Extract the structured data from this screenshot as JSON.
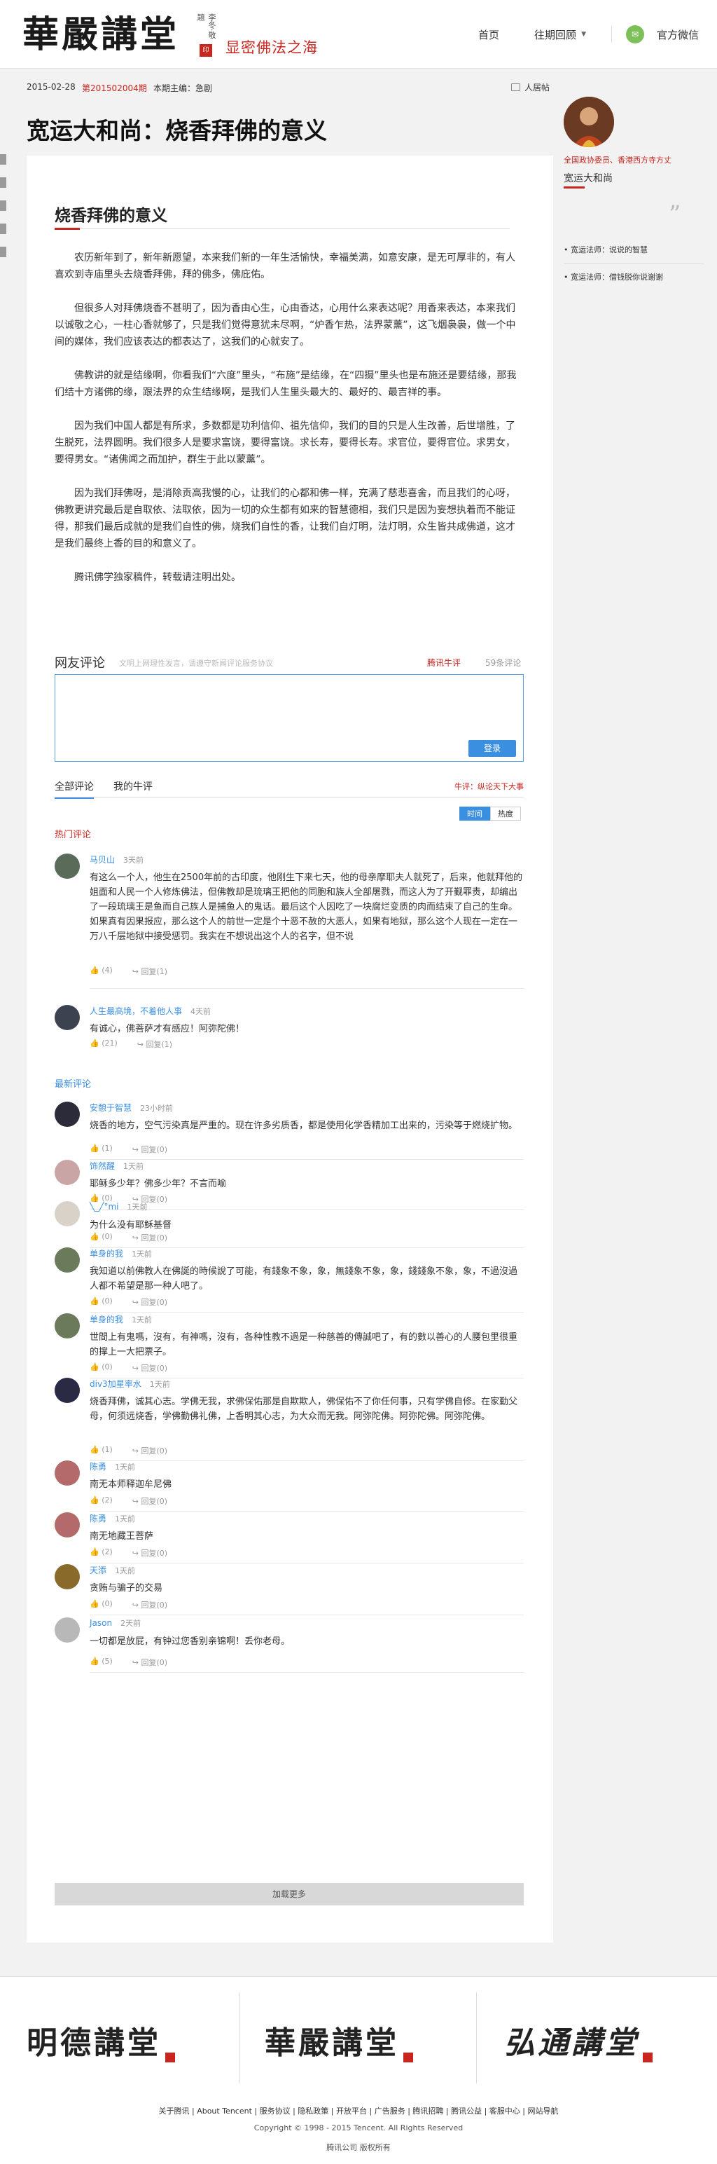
{
  "header": {
    "logo_text": "華嚴講堂",
    "logo_side": "李冬·敬題",
    "slogan": "显密佛法之海",
    "nav_home": "首页",
    "nav_archive": "往期回顾",
    "nav_wechat": "官方微信"
  },
  "infobar": {
    "date": "2015-02-28",
    "issue_prefix": "第",
    "issue_no": "201502004",
    "issue_suffix": "期",
    "editor": "本期主编：急剧",
    "people": "人居帖"
  },
  "page_title": "宽运大和尚：烧香拜佛的意义",
  "article": {
    "title": "烧香拜佛的意义",
    "paragraphs": [
      "农历新年到了，新年新愿望，本来我们新的一年生活愉快，幸福美满，如意安康，是无可厚非的，有人喜欢到寺庙里头去烧香拜佛，拜的佛多，佛庇佑。",
      "但很多人对拜佛烧香不甚明了，因为香由心生，心由香达，心用什么来表达呢？用香来表达，本来我们以诚敬之心，一柱心香就够了，只是我们觉得意犹未尽啊，“炉香乍热，法界蒙薰”，这飞烟袅袅，做一个中间的媒体，我们应该表达的都表达了，这我们的心就安了。",
      "佛教讲的就是结缘啊，你看我们“六度”里头，“布施”是结缘，在“四摄”里头也是布施还是要结缘，那我们结十方诸佛的缘，跟法界的众生结缘啊，是我们人生里头最大的、最好的、最吉祥的事。",
      "因为我们中国人都是有所求，多数都是功利信仰、祖先信仰，我们的目的只是人生改善，后世增胜，了生脱死，法界圆明。我们很多人是要求富饶，要得富饶。求长寿，要得长寿。求官位，要得官位。求男女，要得男女。“诸佛闻之而加护，群生于此以蒙薰”。",
      "因为我们拜佛呀，是消除贡高我慢的心，让我们的心都和佛一样，充满了慈悲喜舍，而且我们的心呀，佛教更讲究最后是自取依、法取依，因为一切的众生都有如来的智慧德相，我们只是因为妄想执着而不能证得，那我们最后成就的是我们自性的佛，烧我们自性的香，让我们自灯明，法灯明，众生皆共成佛道，这才是我们最终上香的目的和意义了。",
      "腾讯佛学独家稿件，转载请注明出处。"
    ]
  },
  "comments": {
    "title": "网友评论",
    "rule": "文明上网理性发言，请遵守新闻评论服务协议",
    "weiping": "腾讯牛评",
    "count": "59条评论",
    "login": "登录",
    "tab_all": "全部评论",
    "tab_mine": "我的牛评",
    "hot_topic": "牛评：纵论天下大事",
    "sort_time": "时间",
    "sort_hot": "热度",
    "hot_label": "热门评论",
    "latest_label": "最新评论",
    "load_more": "加载更多",
    "hot": [
      {
        "name": "马贝山",
        "time": "3天前",
        "text": "有这么一个人，他生在2500年前的古印度，他刚生下来七天，他的母亲摩耶夫人就死了，后来，他就拜他的姐面和人民一个人修炼佛法，但佛教却是琉璃王把他的同胞和族人全部屠戮，而这人为了开觐罪责，却编出了一段琉璃王是鱼而自己族人是捕鱼人的鬼话。最后这个人因吃了一块腐烂变质的肉而结束了自己的生命。如果真有因果报应，那么这个人的前世一定是个十恶不赦的大恶人，如果有地狱，那么这个人现在一定在一万八千层地狱中接受惩罚。我实在不想说出这个人的名字，但不说",
        "likes": "(4)",
        "reply": "回复(1)"
      },
      {
        "name": "人生最高境，不着他人事",
        "time": "4天前",
        "text": "有诚心，佛菩萨才有感应！阿弥陀佛！",
        "likes": "(21)",
        "reply": "回复(1)"
      }
    ],
    "latest": [
      {
        "name": "安憩于智慧",
        "time": "23小时前",
        "text": "烧香的地方，空气污染真是严重的。现在许多劣质香，都是使用化学香精加工出来的，污染等于燃烧扩物。",
        "likes": "(1)",
        "reply": "回复(0)"
      },
      {
        "name": "饰然醒",
        "time": "1天前",
        "text": "耶稣多少年？佛多少年？不言而喻",
        "likes": "(0)",
        "reply": "回复(0)"
      },
      {
        "name": "╲_╱°mi",
        "time": "1天前",
        "text": "为什么没有耶稣基督",
        "likes": "(0)",
        "reply": "回复(0)"
      },
      {
        "name": "单身的我",
        "time": "1天前",
        "text": "我知道以前佛教人在佛誕的時候說了可能，有錢象不象，象，無錢象不象，象，錢錢象不象，象，不過沒過人都不希望是那一种人吧了。",
        "likes": "(0)",
        "reply": "回复(0)"
      },
      {
        "name": "单身的我",
        "time": "1天前",
        "text": "世間上有鬼嗎，沒有，有神嗎，沒有，各种性教不過是一种慈善的傳誠吧了，有的數以善心的人腰包里很重的撑上一大把票子。",
        "likes": "(0)",
        "reply": "回复(0)"
      },
      {
        "name": "div3加星率水",
        "time": "1天前",
        "text": "烧香拜佛，诚其心志。学佛无我，求佛保佑那是自欺欺人，佛保佑不了你任何事，只有学佛自修。在家勤父母，何须远烧香，学佛勤佛礼佛，上香明其心志，为大众而无我。阿弥陀佛。阿弥陀佛。阿弥陀佛。",
        "likes": "(1)",
        "reply": "回复(0)"
      },
      {
        "name": "陈勇",
        "time": "1天前",
        "text": "南无本师释迦牟尼佛",
        "likes": "(2)",
        "reply": "回复(0)"
      },
      {
        "name": "陈勇",
        "time": "1天前",
        "text": "南无地藏王菩萨",
        "likes": "(2)",
        "reply": "回复(0)"
      },
      {
        "name": "天添",
        "time": "1天前",
        "text": "贪贿与骗子的交易",
        "likes": "(0)",
        "reply": "回复(0)"
      },
      {
        "name": "Jason",
        "time": "2天前",
        "text": "一切都是放屁，有钟过您香别亲锦啊！丢你老母。",
        "likes": "(5)",
        "reply": "回复(0)"
      }
    ]
  },
  "sidebar": {
    "role": "全国政协委员、香港西方寺方丈",
    "name": "宽运大和尚",
    "links": [
      "宽运法师：说说的智慧",
      "宽运法师：借钱脱你说谢谢"
    ]
  },
  "footer": {
    "logo1": "明德講堂",
    "logo2": "華嚴講堂",
    "logo3": "弘通講堂",
    "links": "关于腾讯 | About Tencent | 服务协议 | 隐私政策 | 开放平台 | 广告服务 | 腾讯招聘 | 腾讯公益 | 客服中心 | 网站导航",
    "copyright": "Copyright © 1998 - 2015 Tencent. All Rights Reserved",
    "corp": "腾讯公司 版权所有"
  },
  "colors": {
    "accent_red": "#c8261f",
    "accent_blue": "#3b8fe0",
    "wechat_green": "#7dc05a"
  }
}
